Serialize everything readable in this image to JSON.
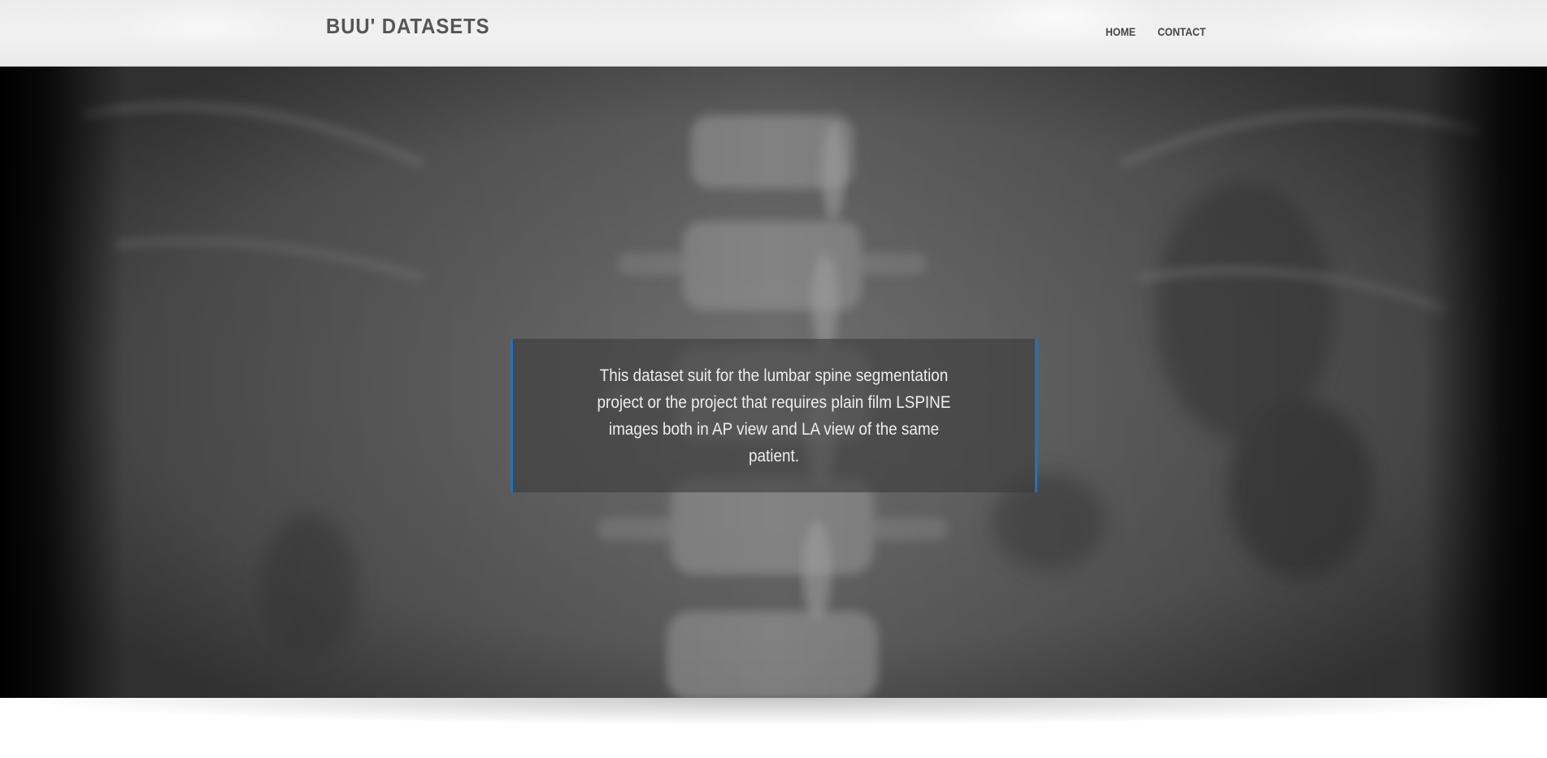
{
  "header": {
    "brand": "BUU' DATASETS",
    "nav": [
      {
        "label": "HOME"
      },
      {
        "label": "CONTACT"
      }
    ]
  },
  "hero": {
    "caption": "This dataset suit for the lumbar spine segmentation project or the project that requires plain film LSPINE images both in AP view and LA view of the same patient.",
    "background_image": "lumbar spine AP x-ray",
    "controls": {
      "prev_icon": "chevron-left-icon",
      "next_icon": "chevron-right-icon"
    }
  },
  "colors": {
    "accent": "#1e73be",
    "header_bg": "#efefef",
    "brand_text": "#555555",
    "caption_text": "#eeeeee"
  }
}
